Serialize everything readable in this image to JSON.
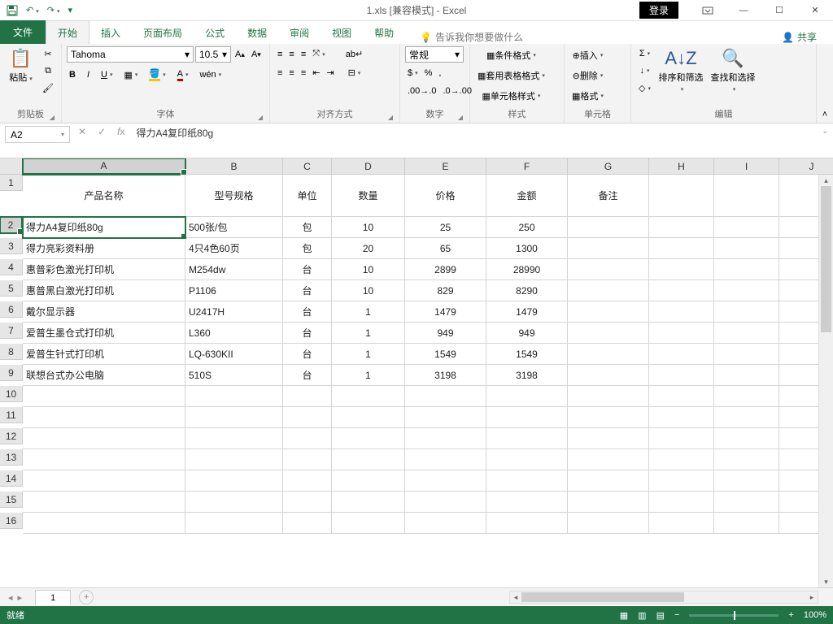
{
  "window": {
    "title": "1.xls [兼容模式] - Excel",
    "login": "登录"
  },
  "tabs": {
    "file": "文件",
    "items": [
      "开始",
      "插入",
      "页面布局",
      "公式",
      "数据",
      "审阅",
      "视图",
      "帮助"
    ],
    "active": 0,
    "tell": "告诉我你想要做什么",
    "share": "共享"
  },
  "ribbon": {
    "clipboard": {
      "paste": "粘贴",
      "label": "剪贴板"
    },
    "font": {
      "name": "Tahoma",
      "size": "10.5",
      "label": "字体"
    },
    "align": {
      "label": "对齐方式"
    },
    "number": {
      "format": "常规",
      "label": "数字"
    },
    "styles": {
      "cond": "条件格式",
      "table": "套用表格格式",
      "cell": "单元格样式",
      "label": "样式"
    },
    "cells": {
      "insert": "插入",
      "delete": "删除",
      "format": "格式",
      "label": "单元格"
    },
    "editing": {
      "sort": "排序和筛选",
      "find": "查找和选择",
      "label": "编辑"
    }
  },
  "fx": {
    "cellref": "A2",
    "value": "得力A4复印纸80g"
  },
  "headers": [
    "产品名称",
    "型号规格",
    "单位",
    "数量",
    "价格",
    "金额",
    "备注"
  ],
  "rows": [
    {
      "a": "得力A4复印纸80g",
      "b": "500张/包",
      "c": "包",
      "d": "10",
      "e": "25",
      "f": "250",
      "g": ""
    },
    {
      "a": "得力亮彩资料册",
      "b": "4只4色60页",
      "c": "包",
      "d": "20",
      "e": "65",
      "f": "1300",
      "g": ""
    },
    {
      "a": "惠普彩色激光打印机",
      "b": "M254dw",
      "c": "台",
      "d": "10",
      "e": "2899",
      "f": "28990",
      "g": ""
    },
    {
      "a": "惠普黑白激光打印机",
      "b": "P1106",
      "c": "台",
      "d": "10",
      "e": "829",
      "f": "8290",
      "g": ""
    },
    {
      "a": "戴尔显示器",
      "b": "U2417H",
      "c": "台",
      "d": "1",
      "e": "1479",
      "f": "1479",
      "g": ""
    },
    {
      "a": "爱普生墨仓式打印机",
      "b": "L360",
      "c": "台",
      "d": "1",
      "e": "949",
      "f": "949",
      "g": ""
    },
    {
      "a": "爱普生针式打印机",
      "b": "LQ-630KII",
      "c": "台",
      "d": "1",
      "e": "1549",
      "f": "1549",
      "g": ""
    },
    {
      "a": "联想台式办公电脑",
      "b": "510S",
      "c": "台",
      "d": "1",
      "e": "3198",
      "f": "3198",
      "g": ""
    }
  ],
  "cols": [
    "A",
    "B",
    "C",
    "D",
    "E",
    "F",
    "G",
    "H",
    "I",
    "J"
  ],
  "sheet": {
    "name": "1"
  },
  "status": {
    "ready": "就绪",
    "zoom": "100%"
  }
}
